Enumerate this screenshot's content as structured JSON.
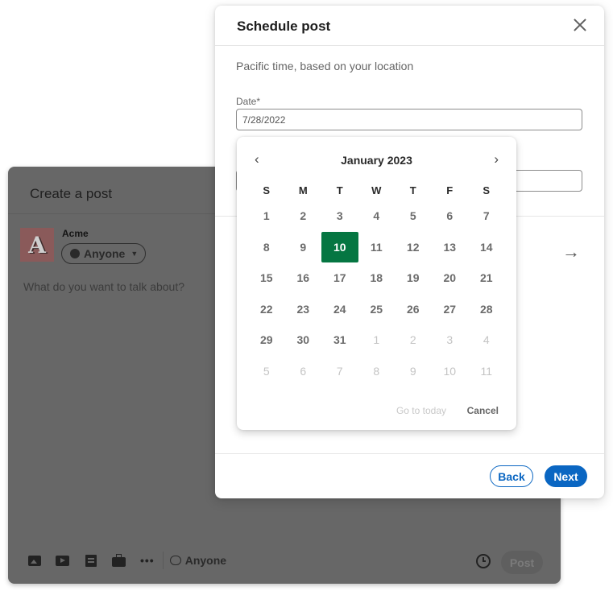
{
  "create_post": {
    "title": "Create a post",
    "author_name": "Acme",
    "avatar_letter": "A",
    "visibility_label": "Anyone",
    "prompt_placeholder": "What do you want to talk about?",
    "toolbar_icons": [
      "photo-icon",
      "video-icon",
      "document-icon",
      "job-icon",
      "more-icon"
    ],
    "comment_scope_label": "Anyone",
    "more_label": "•••",
    "post_label": "Post"
  },
  "schedule_modal": {
    "title": "Schedule post",
    "timezone_note": "Pacific time, based on your location",
    "date_label": "Date*",
    "date_value": "7/28/2022",
    "arrow": "→",
    "back_label": "Back",
    "next_label": "Next"
  },
  "calendar": {
    "month_label": "January 2023",
    "prev_glyph": "‹",
    "next_glyph": "›",
    "weekdays": [
      "S",
      "M",
      "T",
      "W",
      "T",
      "F",
      "S"
    ],
    "days": [
      {
        "d": "1"
      },
      {
        "d": "2"
      },
      {
        "d": "3"
      },
      {
        "d": "4"
      },
      {
        "d": "5"
      },
      {
        "d": "6"
      },
      {
        "d": "7"
      },
      {
        "d": "8"
      },
      {
        "d": "9"
      },
      {
        "d": "10",
        "selected": true
      },
      {
        "d": "11"
      },
      {
        "d": "12"
      },
      {
        "d": "13"
      },
      {
        "d": "14"
      },
      {
        "d": "15"
      },
      {
        "d": "16"
      },
      {
        "d": "17"
      },
      {
        "d": "18"
      },
      {
        "d": "19"
      },
      {
        "d": "20"
      },
      {
        "d": "21"
      },
      {
        "d": "22"
      },
      {
        "d": "23"
      },
      {
        "d": "24"
      },
      {
        "d": "25"
      },
      {
        "d": "26"
      },
      {
        "d": "27"
      },
      {
        "d": "28"
      },
      {
        "d": "29"
      },
      {
        "d": "30"
      },
      {
        "d": "31"
      },
      {
        "d": "1",
        "muted": true
      },
      {
        "d": "2",
        "muted": true
      },
      {
        "d": "3",
        "muted": true
      },
      {
        "d": "4",
        "muted": true
      },
      {
        "d": "5",
        "muted": true
      },
      {
        "d": "6",
        "muted": true
      },
      {
        "d": "7",
        "muted": true
      },
      {
        "d": "8",
        "muted": true
      },
      {
        "d": "9",
        "muted": true
      },
      {
        "d": "10",
        "muted": true
      },
      {
        "d": "11",
        "muted": true
      }
    ],
    "go_to_today_label": "Go to today",
    "cancel_label": "Cancel"
  },
  "colors": {
    "primary_blue": "#0a66c2",
    "selected_green": "#057642",
    "overlay_gray": "#676767"
  }
}
